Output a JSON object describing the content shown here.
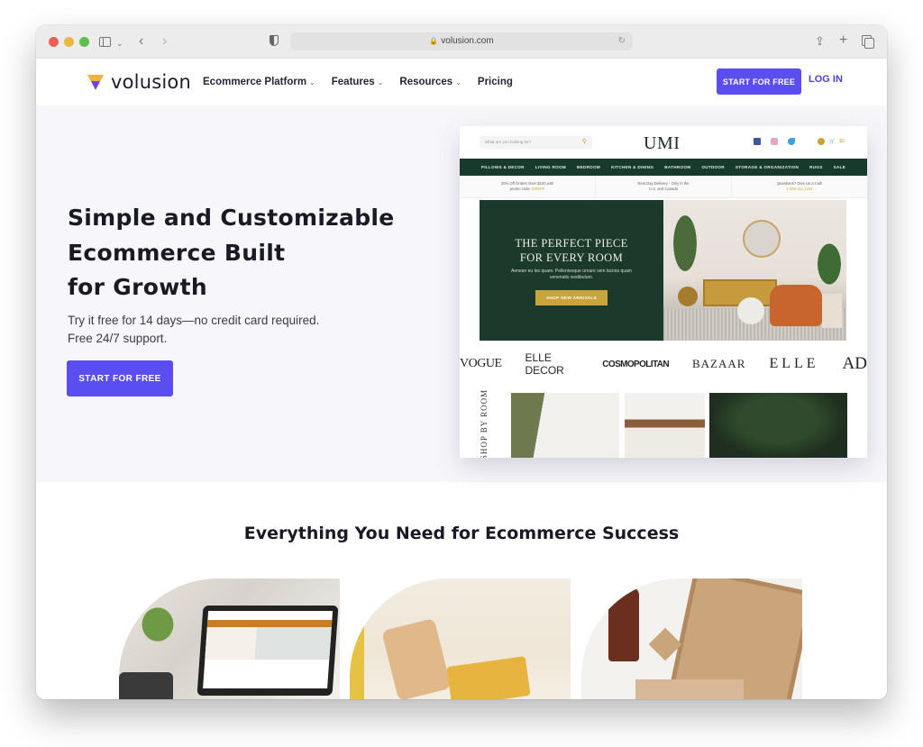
{
  "browser": {
    "url": "volusion.com",
    "icons": [
      "close-dot",
      "minimize-dot",
      "zoom-dot",
      "sidebar-icon",
      "chevron-down-icon",
      "back-icon",
      "forward-icon",
      "privacy-shield-icon",
      "lock-icon",
      "reload-icon",
      "share-icon",
      "new-tab-icon",
      "tab-overview-icon"
    ]
  },
  "header": {
    "logo_text": "volusion",
    "nav": [
      {
        "label": "Ecommerce Platform",
        "has_dropdown": true
      },
      {
        "label": "Features",
        "has_dropdown": true
      },
      {
        "label": "Resources",
        "has_dropdown": true
      },
      {
        "label": "Pricing",
        "has_dropdown": false
      }
    ],
    "cta_label": "START FOR FREE",
    "login_label": "LOG IN"
  },
  "hero": {
    "title_lines": [
      "Simple and Customizable",
      "Ecommerce Built",
      "for Growth"
    ],
    "subtitle": "Try it free for 14 days—no credit card required. Free 24/7 support.",
    "cta_label": "START FOR FREE"
  },
  "umi_preview": {
    "search_placeholder": "What are you looking for?",
    "logo": "UMI",
    "cart_count": "$0",
    "nav": [
      "PILLOWS & DECOR",
      "LIVING ROOM",
      "BEDROOM",
      "KITCHEN & DINING",
      "BATHROOM",
      "OUTDOOR",
      "STORAGE & ORGANIZATION",
      "RUGS",
      "SALE"
    ],
    "promos": [
      {
        "text": "20% Off Orders Over $100 with",
        "line2": "promo code ",
        "highlight": "100OFF"
      },
      {
        "text": "Next Day Delivery - Only in the",
        "line2": "U.S. and Canada",
        "highlight": ""
      },
      {
        "text": "Questions? Give Us a Call!",
        "line2": "",
        "highlight": "1-800-111-1234"
      }
    ],
    "banner": {
      "title_line1": "THE PERFECT PIECE",
      "title_line2": "FOR EVERY ROOM",
      "text": "Aenean eu leo quam. Pellentesque ornare sem lacinia quam venenatis vestibulum.",
      "button": "SHOP NEW ARRIVALS"
    },
    "press": [
      "VOGUE",
      "ELLE DECOR",
      "COSMOPOLITAN",
      "BAZAAR",
      "ELLE",
      "AD"
    ],
    "shop_by_room_label": "SHOP BY ROOM"
  },
  "features": {
    "title": "Everything You Need for Ecommerce Success",
    "cards": [
      {
        "alt": "Laptop showing online store"
      },
      {
        "alt": "Person paying with phone and card"
      },
      {
        "alt": "Packaged products in boxes"
      }
    ]
  },
  "colors": {
    "brand_primary": "#5b4ef0",
    "login_link": "#4a3fd8",
    "umi_green": "#183a2d",
    "umi_gold": "#c9a43a",
    "hero_bg": "#f7f7fb"
  }
}
